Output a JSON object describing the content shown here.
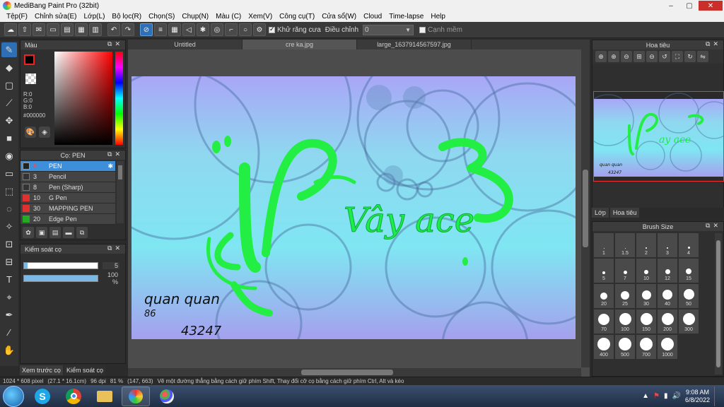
{
  "window": {
    "title": "MediBang Paint Pro (32bit)",
    "min": "–",
    "max": "▢",
    "close": "✕"
  },
  "menu": [
    "Tệp(F)",
    "Chỉnh sửa(E)",
    "Lớp(L)",
    "Bộ lọc(R)",
    "Chọn(S)",
    "Chụp(N)",
    "Màu (C)",
    "Xem(V)",
    "Công cụ(T)",
    "Cửa sổ(W)",
    "Cloud",
    "Time-lapse",
    "Help"
  ],
  "toolbar": {
    "antialias_label": "Khử răng cưa",
    "adjust_label": "Điều chỉnh",
    "adjust_value": "0",
    "sharp_edge_label": "Cạnh mềm"
  },
  "color_panel": {
    "title": "Màu",
    "r": "R:0",
    "g": "G:0",
    "b": "B:0",
    "hex": "#000000"
  },
  "brush_panel": {
    "title": "Cọ: PEN",
    "brushes": [
      {
        "size": "5",
        "name": "PEN",
        "color": "#222222"
      },
      {
        "size": "3",
        "name": "Pencil",
        "color": "#333333"
      },
      {
        "size": "8",
        "name": "Pen (Sharp)",
        "color": "#333333"
      },
      {
        "size": "10",
        "name": "G Pen",
        "color": "#e03030"
      },
      {
        "size": "30",
        "name": "MAPPING PEN",
        "color": "#e03030"
      },
      {
        "size": "20",
        "name": "Edge Pen",
        "color": "#22aa22"
      }
    ]
  },
  "brush_control": {
    "title": "Kiểm soát cọ",
    "size_value": "5",
    "size_fraction": 0.05,
    "opacity_value": "100 %",
    "opacity_fraction": 1.0
  },
  "left_tabs": [
    "Xem trước cọ",
    "Kiểm soát cọ"
  ],
  "doc_tabs": [
    "Untitled",
    "cre ka.jpg",
    "large_1637914567597.jpg"
  ],
  "artwork": {
    "title_text": "Vây ace",
    "signature": "quan quan",
    "sig_num": "86",
    "sig_code": "43247"
  },
  "navigator": {
    "title": "Hoa tiêu"
  },
  "right_tabs": [
    "Lớp",
    "Hoa tiêu"
  ],
  "brush_size": {
    "title": "Brush Size",
    "sizes": [
      "1",
      "1.5",
      "2",
      "3",
      "4",
      "5",
      "7",
      "10",
      "12",
      "15",
      "20",
      "25",
      "30",
      "40",
      "50",
      "70",
      "100",
      "150",
      "200",
      "300",
      "400",
      "500",
      "700",
      "1000"
    ]
  },
  "status": {
    "dims": "1024 * 608 pixel",
    "phys": "(27.1 * 16.1cm)",
    "dpi": "96 dpi",
    "zoom": "81 %",
    "coords": "(147, 663)",
    "hint": "Vẽ một đường thẳng bằng cách giữ phím Shift, Thay đổi cỡ cọ bằng cách giữ phím Ctrl, Alt và kéo"
  },
  "taskbar": {
    "time": "9:08 AM",
    "date": "6/8/2022"
  },
  "colors": {
    "accent": "#2e6fb5",
    "selected_row": "#3d8fd9",
    "close_red": "#c9302c"
  }
}
